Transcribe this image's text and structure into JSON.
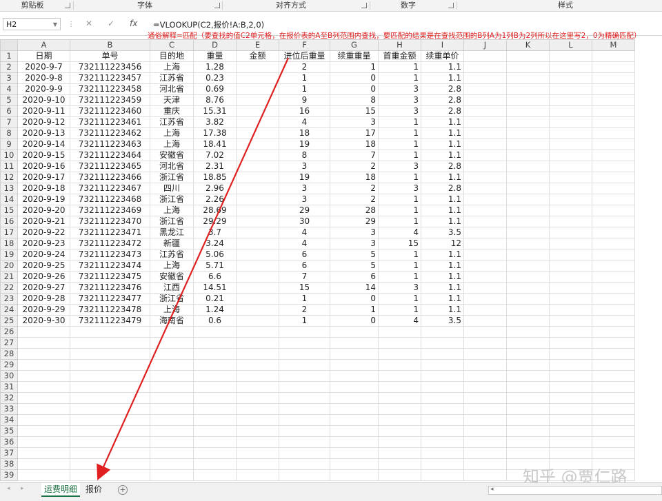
{
  "ribbon": {
    "groups": [
      "剪贴板",
      "字体",
      "对齐方式",
      "数字",
      "样式"
    ]
  },
  "formula_bar": {
    "name_box": "H2",
    "cancel_glyph": "✕",
    "enter_glyph": "✓",
    "fx_glyph": "fx",
    "formula": "=VLOOKUP(C2,报价!A:B,2,0)",
    "annotation": "通俗解释=匹配（要查找的值C2单元格，在报价表的A至B列范围内查找，要匹配的结果是在查找范围的B列A为1列B为2列所以在这里写2，0为精确匹配）"
  },
  "sheet": {
    "columns": [
      "A",
      "B",
      "C",
      "D",
      "E",
      "F",
      "G",
      "H",
      "I",
      "J",
      "K",
      "L",
      "M"
    ],
    "header_row": [
      "日期",
      "单号",
      "目的地",
      "重量",
      "金额",
      "进位后重量",
      "续重重量",
      "首重金额",
      "续重单价",
      "",
      "",
      "",
      ""
    ],
    "rows": [
      [
        "2020-9-7",
        "732111223456",
        "上海",
        "1.28",
        "",
        "2",
        "1",
        "1",
        "1.1"
      ],
      [
        "2020-9-8",
        "732111223457",
        "江苏省",
        "0.23",
        "",
        "1",
        "0",
        "1",
        "1.1"
      ],
      [
        "2020-9-9",
        "732111223458",
        "河北省",
        "0.69",
        "",
        "1",
        "0",
        "3",
        "2.8"
      ],
      [
        "2020-9-10",
        "732111223459",
        "天津",
        "8.76",
        "",
        "9",
        "8",
        "3",
        "2.8"
      ],
      [
        "2020-9-11",
        "732111223460",
        "重庆",
        "15.31",
        "",
        "16",
        "15",
        "3",
        "2.8"
      ],
      [
        "2020-9-12",
        "732111223461",
        "江苏省",
        "3.82",
        "",
        "4",
        "3",
        "1",
        "1.1"
      ],
      [
        "2020-9-13",
        "732111223462",
        "上海",
        "17.38",
        "",
        "18",
        "17",
        "1",
        "1.1"
      ],
      [
        "2020-9-14",
        "732111223463",
        "上海",
        "18.41",
        "",
        "19",
        "18",
        "1",
        "1.1"
      ],
      [
        "2020-9-15",
        "732111223464",
        "安徽省",
        "7.02",
        "",
        "8",
        "7",
        "1",
        "1.1"
      ],
      [
        "2020-9-16",
        "732111223465",
        "河北省",
        "2.31",
        "",
        "3",
        "2",
        "3",
        "2.8"
      ],
      [
        "2020-9-17",
        "732111223466",
        "浙江省",
        "18.85",
        "",
        "19",
        "18",
        "1",
        "1.1"
      ],
      [
        "2020-9-18",
        "732111223467",
        "四川",
        "2.96",
        "",
        "3",
        "2",
        "3",
        "2.8"
      ],
      [
        "2020-9-19",
        "732111223468",
        "浙江省",
        "2.26",
        "",
        "3",
        "2",
        "1",
        "1.1"
      ],
      [
        "2020-9-20",
        "732111223469",
        "上海",
        "28.69",
        "",
        "29",
        "28",
        "1",
        "1.1"
      ],
      [
        "2020-9-21",
        "732111223470",
        "浙江省",
        "29.29",
        "",
        "30",
        "29",
        "1",
        "1.1"
      ],
      [
        "2020-9-22",
        "732111223471",
        "黑龙江",
        "3.7",
        "",
        "4",
        "3",
        "4",
        "3.5"
      ],
      [
        "2020-9-23",
        "732111223472",
        "新疆",
        "3.24",
        "",
        "4",
        "3",
        "15",
        "12"
      ],
      [
        "2020-9-24",
        "732111223473",
        "江苏省",
        "5.06",
        "",
        "6",
        "5",
        "1",
        "1.1"
      ],
      [
        "2020-9-25",
        "732111223474",
        "上海",
        "5.71",
        "",
        "6",
        "5",
        "1",
        "1.1"
      ],
      [
        "2020-9-26",
        "732111223475",
        "安徽省",
        "6.6",
        "",
        "7",
        "6",
        "1",
        "1.1"
      ],
      [
        "2020-9-27",
        "732111223476",
        "江西",
        "14.51",
        "",
        "15",
        "14",
        "3",
        "1.1"
      ],
      [
        "2020-9-28",
        "732111223477",
        "浙江省",
        "0.21",
        "",
        "1",
        "0",
        "1",
        "1.1"
      ],
      [
        "2020-9-29",
        "732111223478",
        "上海",
        "1.24",
        "",
        "2",
        "1",
        "1",
        "1.1"
      ],
      [
        "2020-9-30",
        "732111223479",
        "海南省",
        "0.6",
        "",
        "1",
        "0",
        "4",
        "3.5"
      ]
    ],
    "empty_row_numbers": [
      26,
      27,
      28,
      29,
      30,
      31,
      32,
      33,
      34,
      35,
      36,
      37,
      38,
      39
    ],
    "first_row_number": 1
  },
  "tabs": {
    "nav_prev": "◂",
    "nav_next": "▸",
    "active": "运费明细",
    "second": "报价",
    "add": "+"
  },
  "scroll_arrow": "◂",
  "watermark": "知乎 @贾仁路",
  "colors": {
    "annotation_red": "#e02020",
    "active_tab_green": "#1e7145"
  }
}
